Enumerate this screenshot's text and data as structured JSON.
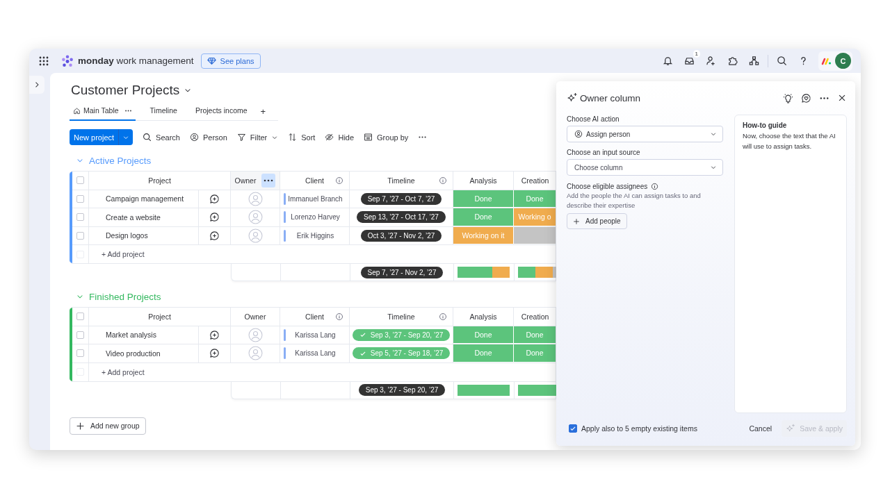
{
  "topbar": {
    "brand": "**monday** work management",
    "plans_button": "See plans",
    "inbox_badge": "1",
    "avatar_initial": "C"
  },
  "board": {
    "title": "Customer Projects",
    "tabs": [
      {
        "label": "Main Table",
        "kind": "home",
        "selected": true
      },
      {
        "label": "Timeline",
        "kind": "plain",
        "selected": false
      },
      {
        "label": "Projects income",
        "kind": "plain",
        "selected": false
      }
    ],
    "add_tab": "+",
    "new_button": "New project",
    "toolbar": [
      {
        "label": "Search",
        "kind": "search"
      },
      {
        "label": "Person",
        "kind": "person"
      },
      {
        "label": "Filter",
        "kind": "filter"
      },
      {
        "label": "Sort",
        "kind": "sort"
      },
      {
        "label": "Hide",
        "kind": "hide"
      },
      {
        "label": "Group by",
        "kind": "group"
      }
    ],
    "groups": [
      {
        "title": "Active Projects",
        "color": "#579bfc",
        "select_all_checked": false,
        "add_row_checked": false,
        "columns": [
          {
            "label": "Project"
          },
          {
            "label": "Owner",
            "active": true
          },
          {
            "label": "Client",
            "info": true
          },
          {
            "label": "Timeline",
            "info": true
          },
          {
            "label": "Analysis"
          },
          {
            "label": "Creation"
          }
        ],
        "rows": [
          {
            "name": "Campaign management",
            "checked": false,
            "client": "Immanuel Branch",
            "timeline": "Sep 7, ’27 - Oct 7, ’27",
            "timeline_done": false,
            "analysis": {
              "label": "Done",
              "color": "#5cc47c"
            },
            "creation": {
              "label": "Done",
              "color": "#5cc47c"
            }
          },
          {
            "name": "Create a website",
            "checked": false,
            "client": "Lorenzo Harvey",
            "timeline": "Sep 13, ’27 - Oct 17, ’27",
            "timeline_done": false,
            "analysis": {
              "label": "Done",
              "color": "#5cc47c"
            },
            "creation": {
              "label": "Working o",
              "color": "#f0ac4e"
            }
          },
          {
            "name": "Design logos",
            "checked": false,
            "client": "Erik Higgins",
            "timeline": "Oct 3, ’27 - Nov 2, ’27",
            "timeline_done": false,
            "analysis": {
              "label": "Working on it",
              "color": "#f0ac4e"
            },
            "creation": {
              "color": "#c4c4c4"
            }
          }
        ],
        "add_row": "+ Add project",
        "summary": {
          "timeline": "Sep 7, ’27 - Nov 2, ’27",
          "analysis": [
            {
              "color": "#5cc47c"
            },
            {
              "color": "#5cc47c"
            },
            {
              "color": "#f0ac4e"
            }
          ],
          "creation": [
            {
              "color": "#5cc47c"
            },
            {
              "color": "#f0ac4e"
            },
            {
              "color": "#c4c4c4"
            }
          ]
        }
      },
      {
        "title": "Finished Projects",
        "color": "#33b85f",
        "select_all_checked": false,
        "add_row_checked": false,
        "columns": [
          {
            "label": "Project"
          },
          {
            "label": "Owner"
          },
          {
            "label": "Client",
            "info": true
          },
          {
            "label": "Timeline",
            "info": true
          },
          {
            "label": "Analysis"
          },
          {
            "label": "Creation"
          }
        ],
        "rows": [
          {
            "name": "Market analysis",
            "checked": false,
            "client": "Karissa Lang",
            "timeline": "Sep 3, ’27 - Sep 20, ’27",
            "timeline_done": true,
            "analysis": {
              "label": "Done",
              "color": "#5cc47c"
            },
            "creation": {
              "label": "Done",
              "color": "#5cc47c"
            }
          },
          {
            "name": "Video production",
            "checked": false,
            "client": "Karissa Lang",
            "timeline": "Sep 5, ’27 - Sep 18, ’27",
            "timeline_done": true,
            "analysis": {
              "label": "Done",
              "color": "#5cc47c"
            },
            "creation": {
              "label": "Done",
              "color": "#5cc47c"
            }
          }
        ],
        "add_row": "+ Add project",
        "summary": {
          "timeline": "Sep 3, ’27 - Sep 20, ’27",
          "analysis": [
            {
              "color": "#5cc47c"
            },
            {
              "color": "#5cc47c"
            }
          ],
          "creation": [
            {
              "color": "#5cc47c"
            },
            {
              "color": "#5cc47c"
            }
          ]
        }
      }
    ],
    "add_group": "Add new group"
  },
  "panel": {
    "title": "Owner column",
    "fields": [
      {
        "label": "Choose AI action",
        "value": "Assign person"
      },
      {
        "label": "Choose an input source",
        "placeholder": "Choose column"
      }
    ],
    "assignees": {
      "label": "Choose eligible assignees",
      "description": "Add the people the AI can assign tasks to and describe their expertise",
      "button": "Add people"
    },
    "guide": {
      "title": "How-to guide",
      "text": "Now, choose the text that the AI will use to assign tasks."
    },
    "footer": {
      "apply_label": "Apply also to 5 empty existing items",
      "apply_checked": true,
      "cancel": "Cancel",
      "save": "Save & apply",
      "save_disabled": true
    }
  }
}
